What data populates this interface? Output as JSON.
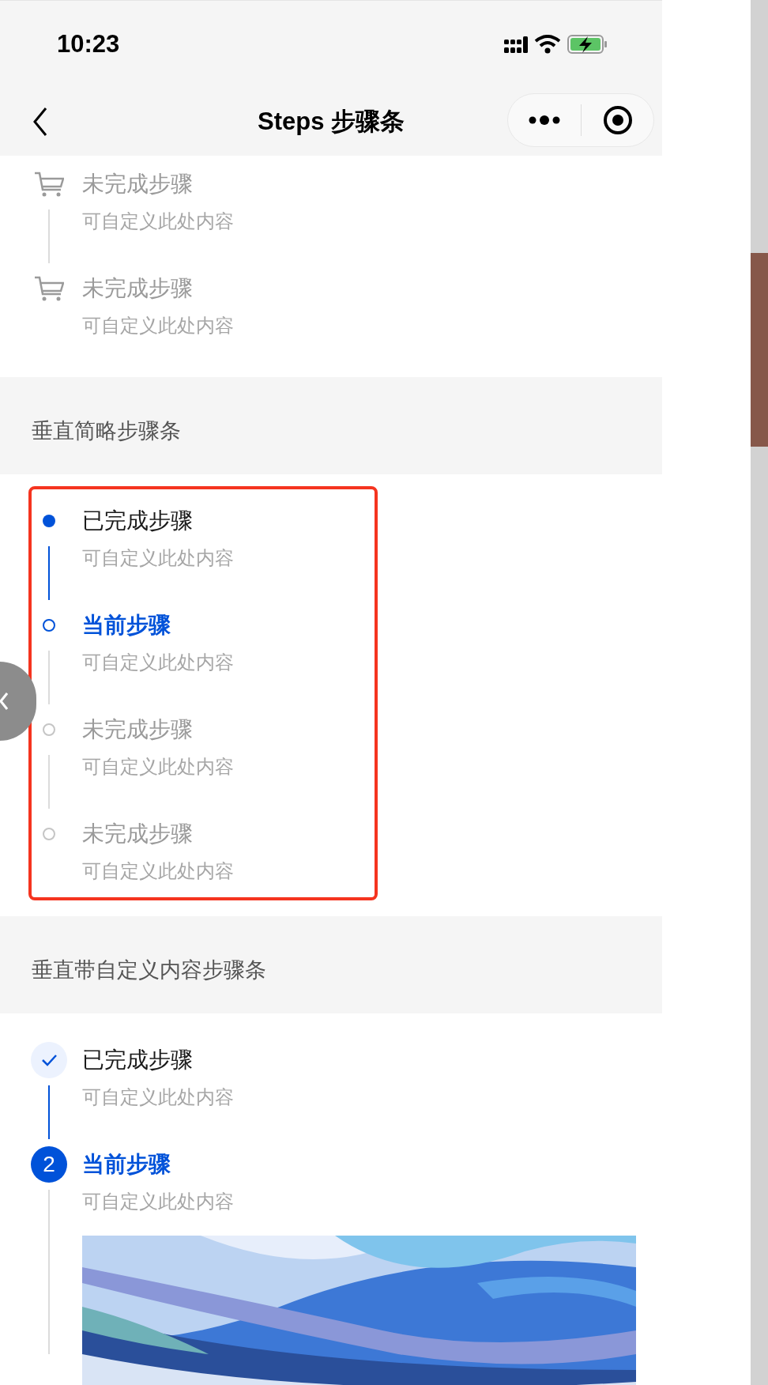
{
  "status_bar": {
    "time": "10:23"
  },
  "nav": {
    "title": "Steps 步骤条"
  },
  "top_steps": [
    {
      "title": "未完成步骤",
      "description": "可自定义此处内容",
      "finished": false,
      "current": false
    },
    {
      "title": "未完成步骤",
      "description": "可自定义此处内容",
      "finished": false,
      "current": false
    }
  ],
  "sections": [
    {
      "title": "垂直简略步骤条",
      "highlighted": true,
      "kind": "dot",
      "steps": [
        {
          "title": "已完成步骤",
          "description": "可自定义此处内容",
          "finished": true,
          "current": false
        },
        {
          "title": "当前步骤",
          "description": "可自定义此处内容",
          "finished": false,
          "current": true
        },
        {
          "title": "未完成步骤",
          "description": "可自定义此处内容",
          "finished": false,
          "current": false
        },
        {
          "title": "未完成步骤",
          "description": "可自定义此处内容",
          "finished": false,
          "current": false
        }
      ]
    },
    {
      "title": "垂直带自定义内容步骤条",
      "highlighted": false,
      "kind": "number",
      "steps": [
        {
          "title": "已完成步骤",
          "description": "可自定义此处内容",
          "finished": true,
          "current": false
        },
        {
          "title": "当前步骤",
          "description": "可自定义此处内容",
          "finished": false,
          "current": true,
          "number": "2"
        }
      ]
    }
  ]
}
